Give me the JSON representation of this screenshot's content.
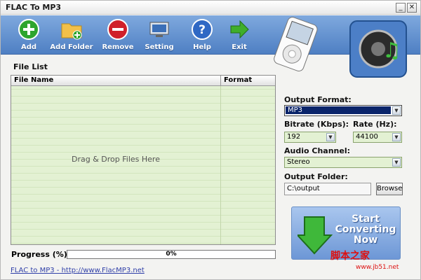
{
  "window": {
    "title": "FLAC To MP3"
  },
  "toolbar": {
    "buttons": [
      {
        "label": "Add",
        "icon": "plus-circle-icon"
      },
      {
        "label": "Add Folder",
        "icon": "folder-add-icon"
      },
      {
        "label": "Remove",
        "icon": "minus-circle-icon"
      },
      {
        "label": "Setting",
        "icon": "monitor-icon"
      },
      {
        "label": "Help",
        "icon": "help-icon"
      },
      {
        "label": "Exit",
        "icon": "arrow-right-icon"
      }
    ]
  },
  "file_list": {
    "label": "File List",
    "columns": [
      "File Name",
      "Format"
    ],
    "placeholder": "Drag & Drop Files Here"
  },
  "output_format": {
    "label": "Output Format:",
    "value": "MP3"
  },
  "bitrate": {
    "label": "Bitrate (Kbps):",
    "value": "192"
  },
  "rate": {
    "label": "Rate (Hz):",
    "value": "44100"
  },
  "audio_channel": {
    "label": "Audio Channel:",
    "value": "Stereo"
  },
  "output_folder": {
    "label": "Output Folder:",
    "value": "C:\\output",
    "browse_label": "Browse"
  },
  "start_button": {
    "line1": "Start",
    "line2": "Converting",
    "line3": "Now"
  },
  "progress": {
    "label": "Progress (%):",
    "value": 0,
    "text": "0%"
  },
  "footer": {
    "link": "FLAC to MP3 - http://www.FlacMP3.net"
  },
  "watermark": {
    "text": "脚本之家",
    "url": "www.jb51.net"
  },
  "colors": {
    "toolbar": "#5a88c9",
    "list_bg": "#e3f1d3",
    "accent": "#0a246a"
  }
}
